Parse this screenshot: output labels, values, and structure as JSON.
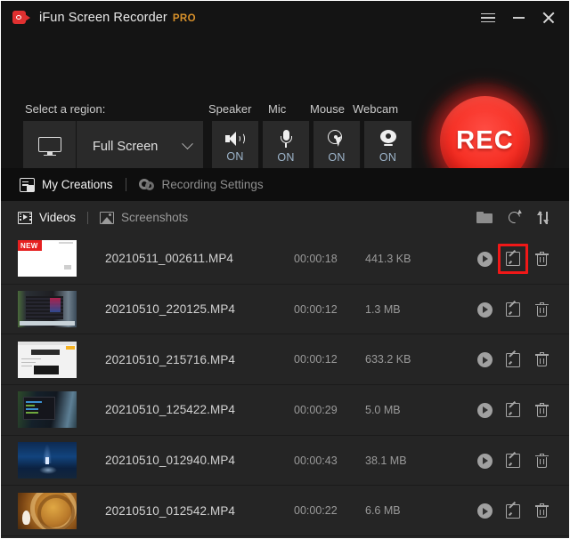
{
  "window": {
    "app_name": "iFun Screen Recorder",
    "edition_badge": "PRO",
    "logo_icon": "video-camera-icon",
    "menu_icon": "hamburger-menu-icon",
    "minimize_icon": "minimize-icon",
    "close_icon": "close-icon"
  },
  "control_panel": {
    "region_label": "Select a region:",
    "region_icon": "monitor-icon",
    "region_value": "Full Screen",
    "region_dropdown_icon": "chevron-down-icon",
    "toggles": [
      {
        "label": "Speaker",
        "state": "ON",
        "icon": "speaker-icon"
      },
      {
        "label": "Mic",
        "state": "ON",
        "icon": "microphone-icon"
      },
      {
        "label": "Mouse",
        "state": "ON",
        "icon": "mouse-cursor-icon"
      },
      {
        "label": "Webcam",
        "state": "ON",
        "icon": "webcam-icon"
      }
    ],
    "record_button_label": "REC",
    "record_button_color": "#f63126"
  },
  "nav": {
    "my_creations": "My Creations",
    "my_creations_icon": "creations-icon",
    "recording_settings": "Recording Settings",
    "recording_settings_icon": "gear-icon"
  },
  "tabs": {
    "videos": "Videos",
    "videos_icon": "film-icon",
    "screenshots": "Screenshots",
    "screenshots_icon": "picture-icon",
    "tools": {
      "open_folder_icon": "folder-icon",
      "refresh_icon": "refresh-icon",
      "sort_icon": "sort-arrows-icon"
    }
  },
  "file_list": {
    "new_badge": "NEW",
    "action_icons": {
      "play": "play-icon",
      "edit": "edit-icon",
      "delete": "trash-icon"
    },
    "highlight_color": "#f01818",
    "rows": [
      {
        "name": "20210511_002611.MP4",
        "duration": "00:00:18",
        "size": "441.3 KB",
        "is_new": true,
        "thumb": "th-white",
        "highlight_edit": true
      },
      {
        "name": "20210510_220125.MP4",
        "duration": "00:00:12",
        "size": "1.3 MB",
        "is_new": false,
        "thumb": "th-dark1",
        "highlight_edit": false
      },
      {
        "name": "20210510_215716.MP4",
        "duration": "00:00:12",
        "size": "633.2 KB",
        "is_new": false,
        "thumb": "th-doc",
        "highlight_edit": false
      },
      {
        "name": "20210510_125422.MP4",
        "duration": "00:00:29",
        "size": "5.0 MB",
        "is_new": false,
        "thumb": "th-forest",
        "highlight_edit": false
      },
      {
        "name": "20210510_012940.MP4",
        "duration": "00:00:43",
        "size": "38.1 MB",
        "is_new": false,
        "thumb": "th-night",
        "highlight_edit": false
      },
      {
        "name": "20210510_012542.MP4",
        "duration": "00:00:22",
        "size": "6.6 MB",
        "is_new": false,
        "thumb": "th-gold",
        "highlight_edit": false
      }
    ]
  }
}
